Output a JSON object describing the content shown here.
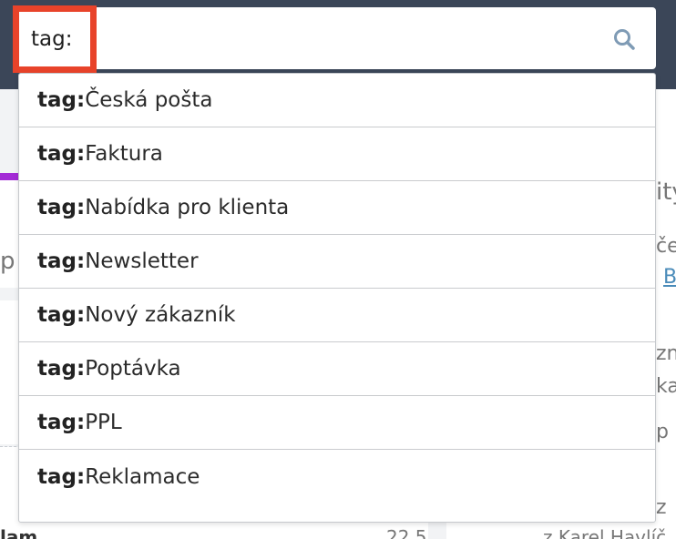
{
  "search": {
    "query_prefix": "tag:",
    "value": ""
  },
  "suggestions": [
    {
      "prefix": "tag:",
      "label": "Česká pošta"
    },
    {
      "prefix": "tag:",
      "label": "Faktura"
    },
    {
      "prefix": "tag:",
      "label": "Nabídka pro klienta"
    },
    {
      "prefix": "tag:",
      "label": "Newsletter"
    },
    {
      "prefix": "tag:",
      "label": "Nový zákazník"
    },
    {
      "prefix": "tag:",
      "label": "Poptávka"
    },
    {
      "prefix": "tag:",
      "label": "PPL"
    },
    {
      "prefix": "tag:",
      "label": "Reklamace"
    }
  ],
  "background": {
    "right_fragments": [
      "ity",
      "če",
      "B",
      "zn",
      "ka",
      "p",
      "z",
      "z Karel Havlíč"
    ],
    "left_fragments": [
      "p",
      "lam",
      "22.5"
    ]
  },
  "colors": {
    "header": "#3b4658",
    "highlight_border": "#e8432a",
    "accent_purple": "#a42bd6",
    "search_icon": "#7f9bb5"
  },
  "icons": {
    "search": "search-icon"
  }
}
